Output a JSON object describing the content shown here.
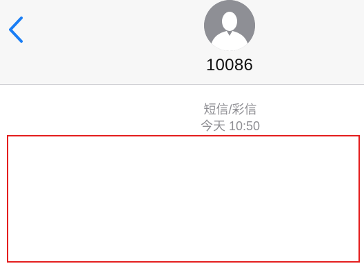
{
  "header": {
    "contact_name": "10086",
    "back_icon": "chevron-left-icon",
    "avatar_icon": "person-silhouette-icon"
  },
  "conversation": {
    "message_type": "短信/彩信",
    "timestamp": "今天 10:50"
  },
  "colors": {
    "accent": "#1a7ef5",
    "nav_background": "#f7f7f7",
    "meta_text": "#8e8e93",
    "highlight": "#e41e1e",
    "avatar_background": "#8e8f95"
  }
}
